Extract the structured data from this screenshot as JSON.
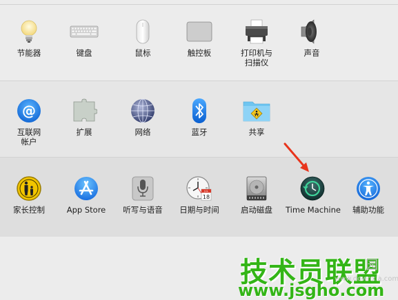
{
  "rows": [
    {
      "items": [
        {
          "label": "节能器",
          "icon": "bulb-icon"
        },
        {
          "label": "键盘",
          "icon": "keyboard-icon"
        },
        {
          "label": "鼠标",
          "icon": "mouse-icon"
        },
        {
          "label": "触控板",
          "icon": "trackpad-icon"
        },
        {
          "label": "打印机与\n扫描仪",
          "icon": "printer-icon"
        },
        {
          "label": "声音",
          "icon": "speaker-icon"
        }
      ]
    },
    {
      "items": [
        {
          "label": "互联网\n帐户",
          "icon": "at-icon"
        },
        {
          "label": "扩展",
          "icon": "puzzle-icon"
        },
        {
          "label": "网络",
          "icon": "globe-icon"
        },
        {
          "label": "蓝牙",
          "icon": "bluetooth-icon"
        },
        {
          "label": "共享",
          "icon": "shared-folder-icon"
        }
      ]
    },
    {
      "items": [
        {
          "label": "家长控制",
          "icon": "parental-controls-icon"
        },
        {
          "label": "App Store",
          "icon": "app-store-icon"
        },
        {
          "label": "听写与语音",
          "icon": "microphone-icon"
        },
        {
          "label": "日期与时间",
          "icon": "clock-calendar-icon"
        },
        {
          "label": "启动磁盘",
          "icon": "hard-disk-icon"
        },
        {
          "label": "Time Machine",
          "icon": "time-machine-icon"
        },
        {
          "label": "辅助功能",
          "icon": "accessibility-icon"
        }
      ]
    }
  ],
  "calendar_day": "18",
  "calendar_month": "JUL",
  "watermark": {
    "main": "技术员联盟",
    "side": "园",
    "url": "www.jsgho.com",
    "url2": "www.downxia.com"
  },
  "colors": {
    "annotation_arrow": "#e8341c",
    "watermark_green": "#33b516"
  }
}
